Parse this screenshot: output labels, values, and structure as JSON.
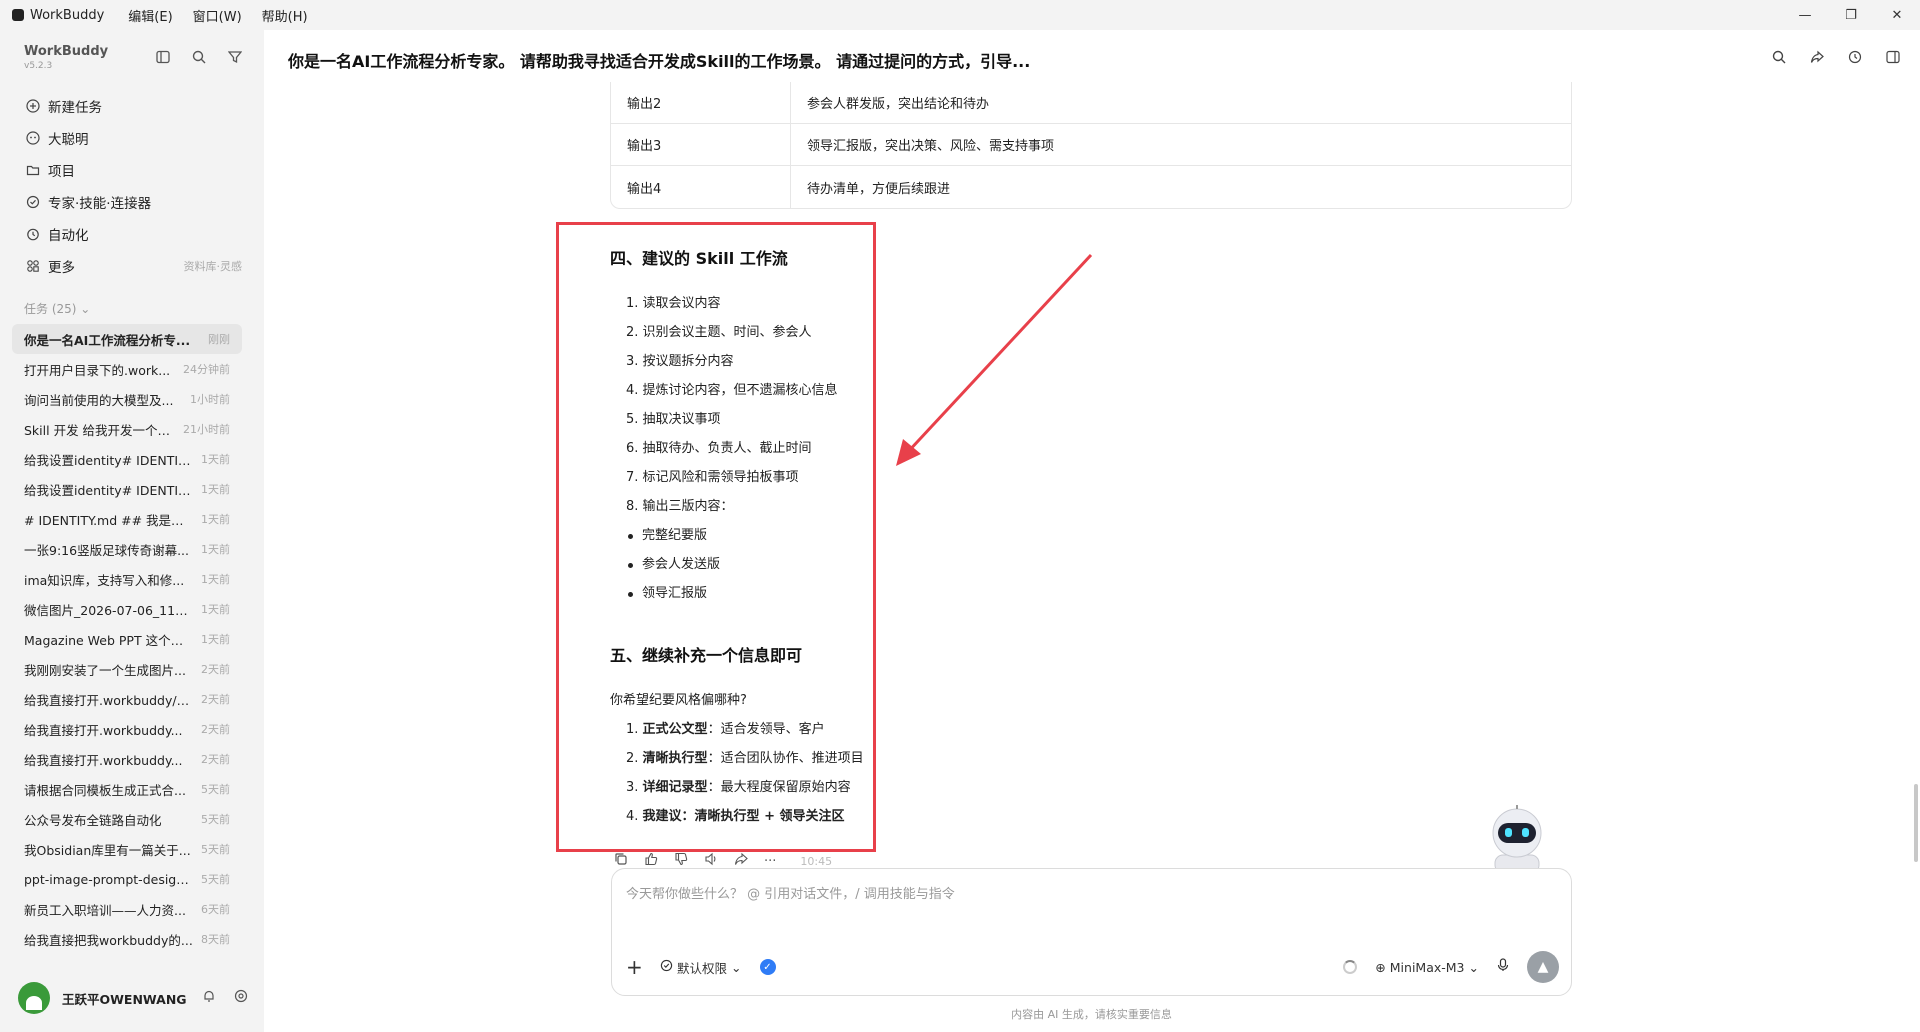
{
  "titlebar": {
    "app_name": "WorkBuddy",
    "menus": [
      "编辑(E)",
      "窗口(W)",
      "帮助(H)"
    ],
    "controls": [
      "—",
      "❐",
      "✕"
    ]
  },
  "sidebar": {
    "brand": "WorkBuddy",
    "version": "v5.2.3",
    "nav": [
      {
        "label": "新建任务",
        "icon": "plus-circle-icon",
        "extra": ""
      },
      {
        "label": "大聪明",
        "icon": "robot-icon",
        "extra": ""
      },
      {
        "label": "项目",
        "icon": "folder-icon",
        "extra": ""
      },
      {
        "label": "专家·技能·连接器",
        "icon": "expert-icon",
        "extra": ""
      },
      {
        "label": "自动化",
        "icon": "clock-icon",
        "extra": ""
      },
      {
        "label": "更多",
        "icon": "grid-icon",
        "extra": "资料库·灵感"
      }
    ],
    "tasks_header": "任务 (25)",
    "tasks": [
      {
        "title": "你是一名AI工作流程分析专...",
        "time": "刚刚"
      },
      {
        "title": "打开用户目录下的.work...",
        "time": "24分钟前"
      },
      {
        "title": "询问当前使用的大模型及...",
        "time": "1小时前"
      },
      {
        "title": "Skill 开发 给我开发一个s...",
        "time": "21小时前"
      },
      {
        "title": "给我设置identity# IDENTIT...",
        "time": "1天前"
      },
      {
        "title": "给我设置identity# IDENTIT...",
        "time": "1天前"
      },
      {
        "title": "# IDENTITY.md ## 我是谁 ...",
        "time": "1天前"
      },
      {
        "title": "一张9:16竖版足球传奇谢幕...",
        "time": "1天前"
      },
      {
        "title": "ima知识库，支持写入和修...",
        "time": "1天前"
      },
      {
        "title": "微信图片_2026-07-06_1143...",
        "time": "1天前"
      },
      {
        "title": "Magazine Web PPT 这个技...",
        "time": "1天前"
      },
      {
        "title": "我刚刚安装了一个生成图片...",
        "time": "2天前"
      },
      {
        "title": "给我直接打开.workbuddy/s...",
        "time": "2天前"
      },
      {
        "title": "给我直接打开.workbuddy...",
        "time": "2天前"
      },
      {
        "title": "给我直接打开.workbuddy...",
        "time": "2天前"
      },
      {
        "title": "请根据合同模板生成正式合...",
        "time": "5天前"
      },
      {
        "title": "公众号发布全链路自动化",
        "time": "5天前"
      },
      {
        "title": "我Obsidian库里有一篇关于...",
        "time": "5天前"
      },
      {
        "title": "ppt-image-prompt-design...",
        "time": "5天前"
      },
      {
        "title": "新员工入职培训——人力资...",
        "time": "6天前"
      },
      {
        "title": "给我直接把我workbuddy的...",
        "time": "8天前"
      }
    ],
    "user": "王跃平OWENWANG"
  },
  "main": {
    "title": "你是一名AI工作流程分析专家。 请帮助我寻找适合开发成Skill的工作场景。 请通过提问的方式，引导...",
    "table": [
      {
        "k": "输出2",
        "v": "参会人群发版，突出结论和待办"
      },
      {
        "k": "输出3",
        "v": "领导汇报版，突出决策、风险、需支持事项"
      },
      {
        "k": "输出4",
        "v": "待办清单，方便后续跟进"
      }
    ],
    "section4_title": "四、建议的 Skill 工作流",
    "steps": [
      "1. 读取会议内容",
      "2. 识别会议主题、时间、参会人",
      "3. 按议题拆分内容",
      "4. 提炼讨论内容，但不遗漏核心信息",
      "5. 抽取决议事项",
      "6. 抽取待办、负责人、截止时间",
      "7. 标记风险和需领导拍板事项",
      "8. 输出三版内容："
    ],
    "bullets": [
      "完整纪要版",
      "参会人发送版",
      "领导汇报版"
    ],
    "section5_title": "五、继续补充一个信息即可",
    "question": "你希望纪要风格偏哪种?",
    "options": [
      {
        "num": "1.",
        "bold": "正式公文型",
        "rest": "：适合发领导、客户"
      },
      {
        "num": "2.",
        "bold": "清晰执行型",
        "rest": "：适合团队协作、推进项目"
      },
      {
        "num": "3.",
        "bold": "详细记录型",
        "rest": "：最大程度保留原始内容"
      },
      {
        "num": "4.",
        "bold": "我建议：清晰执行型 + 领导关注区",
        "rest": ""
      }
    ],
    "msg_time": "10:45"
  },
  "input": {
    "placeholder": "今天帮你做些什么？ @ 引用对话文件，/ 调用技能与指令",
    "permission": "默认权限",
    "model": "MiniMax-M3"
  },
  "footnote": "内容由 AI 生成，请核实重要信息",
  "colors": {
    "annotation_red": "#e8404a",
    "accent_blue": "#2f7cf6"
  }
}
